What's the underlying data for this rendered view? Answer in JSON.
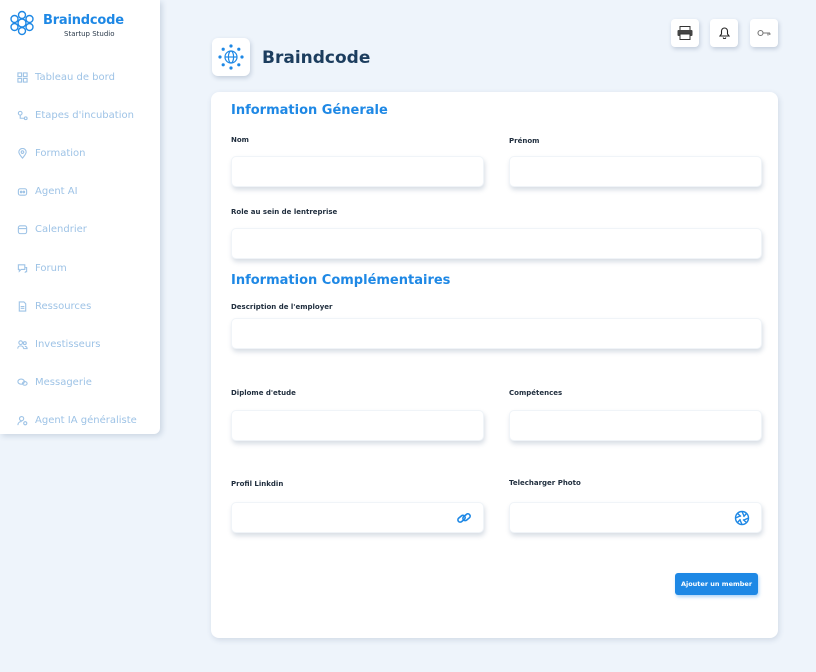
{
  "brand": {
    "name": "Braindcode",
    "subtitle": "Startup Studio"
  },
  "sidebar": {
    "items": [
      {
        "label": "Tableau de bord",
        "icon": "dashboard-icon"
      },
      {
        "label": "Etapes d'incubation",
        "icon": "steps-icon"
      },
      {
        "label": "Formation",
        "icon": "location-icon"
      },
      {
        "label": "Agent AI",
        "icon": "robot-icon"
      },
      {
        "label": "Calendrier",
        "icon": "calendar-icon"
      },
      {
        "label": "Forum",
        "icon": "chat-icon"
      },
      {
        "label": "Ressources",
        "icon": "document-icon"
      },
      {
        "label": "Investisseurs",
        "icon": "people-icon"
      },
      {
        "label": "Messagerie",
        "icon": "message-icon"
      },
      {
        "label": "Agent IA généraliste",
        "icon": "user-ai-icon"
      }
    ]
  },
  "topbar": {
    "icons": [
      "printer-icon",
      "bell-icon",
      "key-icon"
    ]
  },
  "header": {
    "title": "Braindcode"
  },
  "form": {
    "section_general": "Information Génerale",
    "nom_label": "Nom",
    "prenom_label": "Prénom",
    "role_label": "Role au sein de lentreprise",
    "section_complementary": "Information Complémentaires",
    "description_label": "Description  de l'employer",
    "diplome_label": "Diplome d'etude",
    "competences_label": "Compétences",
    "linkedin_label": "Profil Linkdin",
    "photo_label": "Telecharger Photo",
    "submit_label": "Ajouter un member",
    "values": {
      "nom": "",
      "prenom": "",
      "role": "",
      "description": "",
      "diplome": "",
      "competences": "",
      "linkedin": "",
      "photo": ""
    }
  },
  "colors": {
    "accent": "#1e88e5",
    "nav_text": "#9ec3e6",
    "background": "#eef4fb"
  }
}
